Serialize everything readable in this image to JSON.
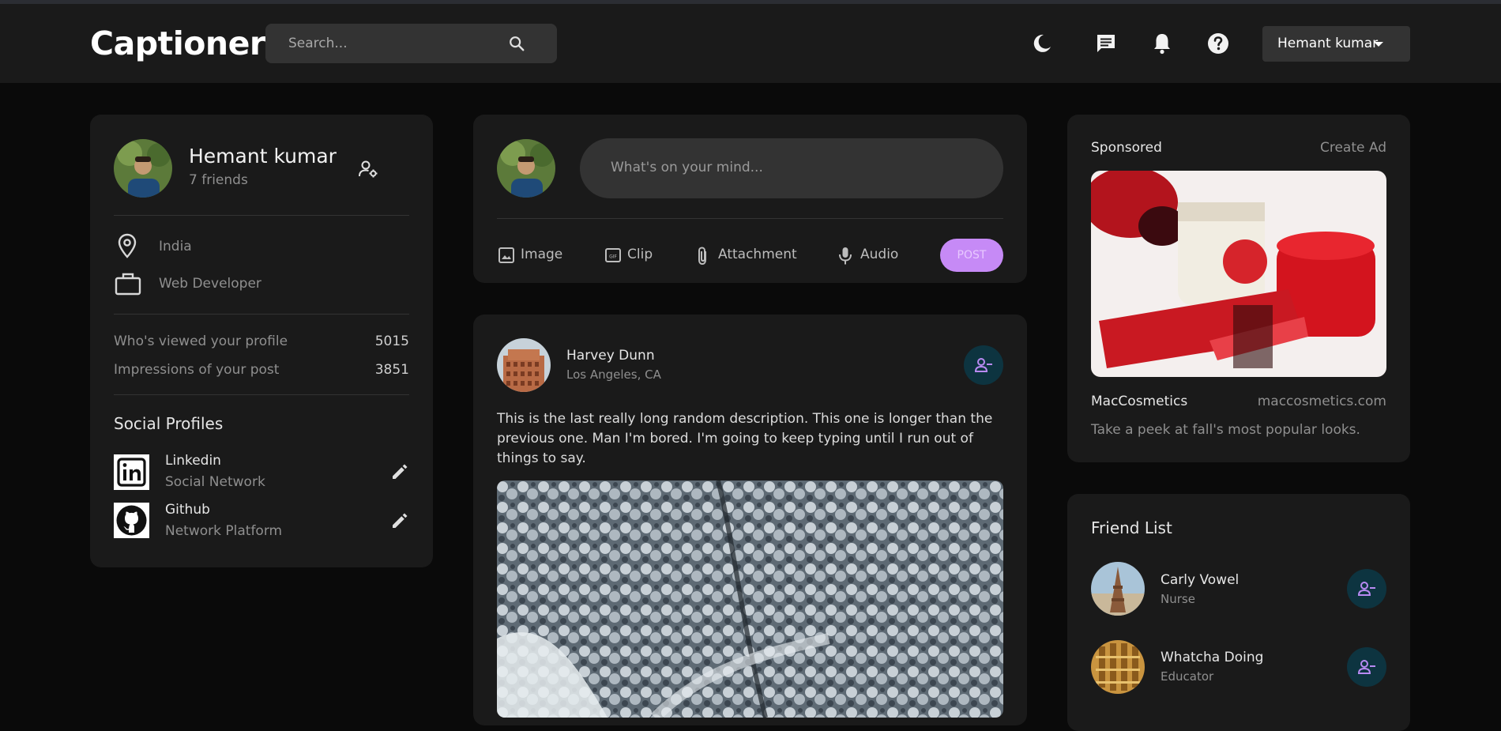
{
  "app": {
    "brand": "Captioner"
  },
  "search": {
    "placeholder": "Search..."
  },
  "nav": {
    "icons": [
      "moon-icon",
      "message-icon",
      "bell-icon",
      "help-icon"
    ],
    "user_name": "Hemant kumar"
  },
  "profile": {
    "name": "Hemant kumar",
    "friends": "7 friends",
    "location": "India",
    "occupation": "Web Developer",
    "stats": [
      {
        "label": "Who's viewed your profile",
        "value": "5015"
      },
      {
        "label": "Impressions of your post",
        "value": "3851"
      }
    ],
    "social_title": "Social Profiles",
    "socials": [
      {
        "name": "Linkedin",
        "type": "Social Network"
      },
      {
        "name": "Github",
        "type": "Network Platform"
      }
    ]
  },
  "composer": {
    "placeholder": "What's on your mind...",
    "actions": [
      "Image",
      "Clip",
      "Attachment",
      "Audio"
    ],
    "post_label": "POST"
  },
  "post": {
    "author": "Harvey Dunn",
    "location": "Los Angeles, CA",
    "text": "This is the last really long random description. This one is longer than the previous one. Man I'm bored. I'm going to keep typing until I run out of things to say."
  },
  "ad": {
    "title": "Sponsored",
    "create": "Create Ad",
    "brand": "MacCosmetics",
    "site": "maccosmetics.com",
    "desc": "Take a peek at fall's most popular looks."
  },
  "friends": {
    "title": "Friend List",
    "items": [
      {
        "name": "Carly Vowel",
        "role": "Nurse"
      },
      {
        "name": "Whatcha Doing",
        "role": "Educator"
      }
    ]
  },
  "colors": {
    "accent": "#c68af6",
    "bg": "#0a0a0a",
    "card": "#1a1a1a",
    "input": "#333333"
  }
}
